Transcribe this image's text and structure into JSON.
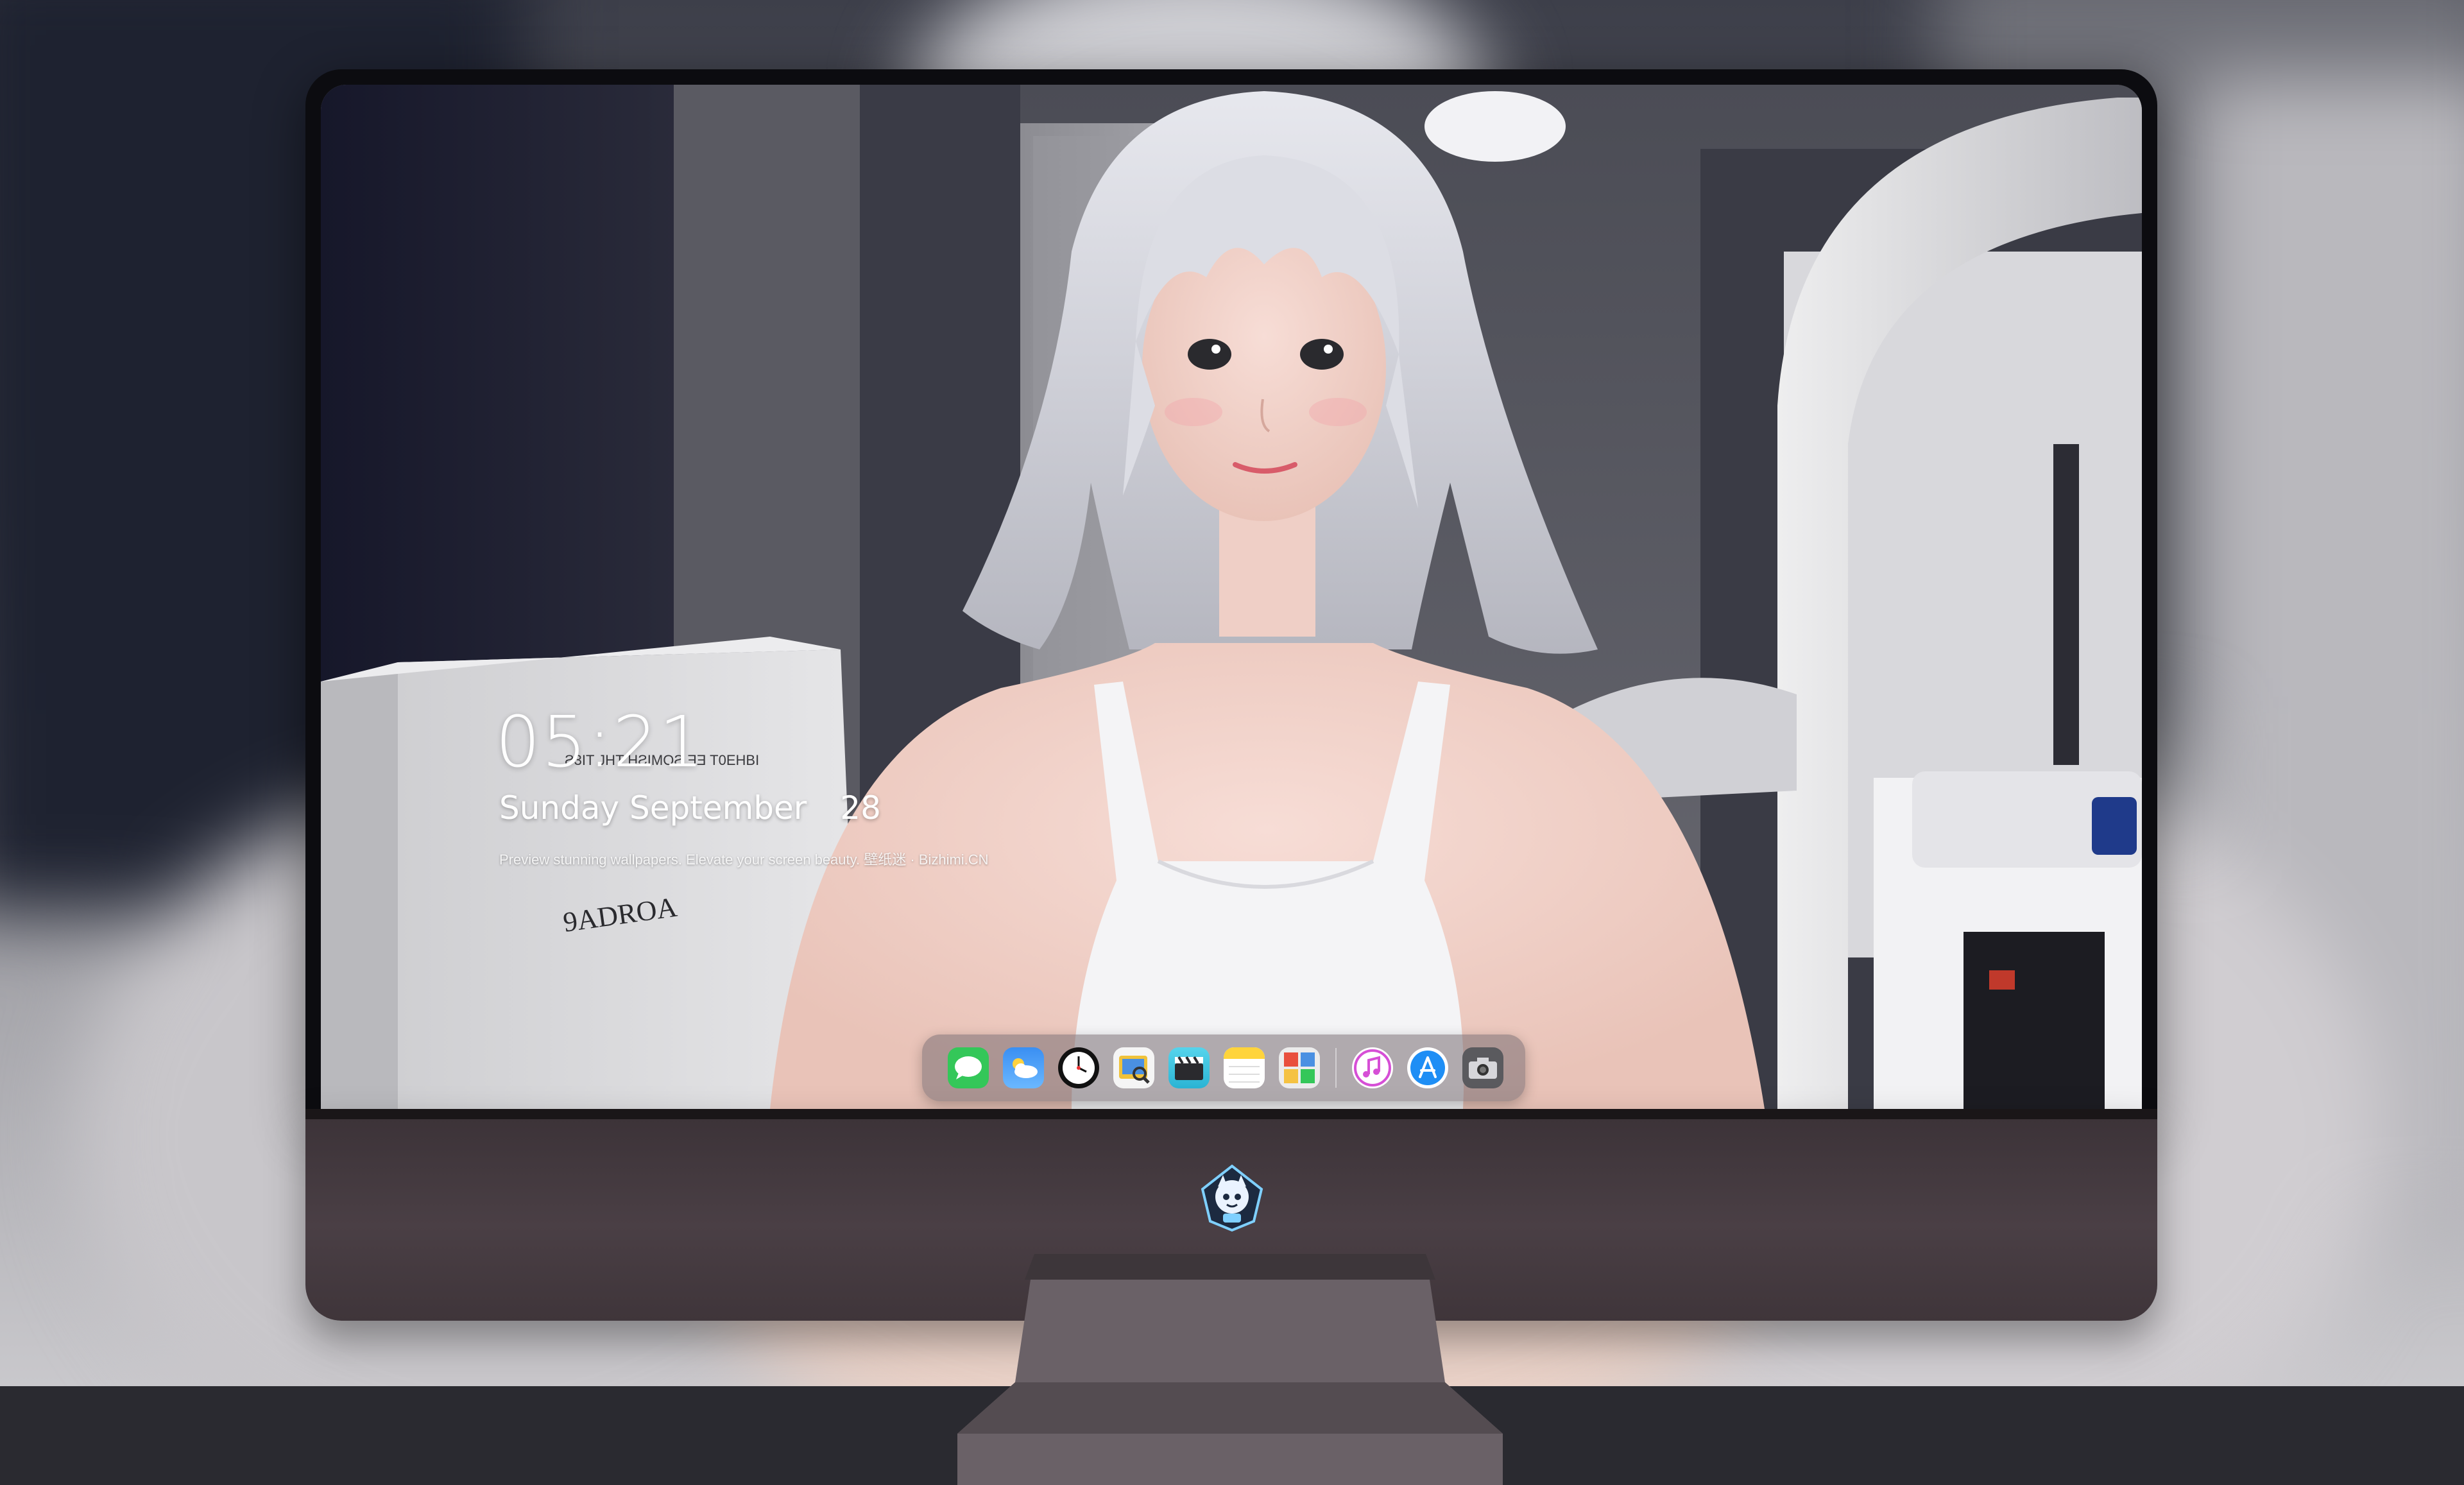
{
  "lockscreen": {
    "time": "05:21",
    "weekday": "Sunday",
    "month": "September",
    "day": "28",
    "tagline": "Preview stunning wallpapers. Elevate your screen beauty. 壁纸迷 · Bizhimi.CN"
  },
  "wallpaper": {
    "box_text_top": "Ƨ3IT JHT HƧIMOƧ ƎƎ T0EHBI",
    "box_text_brand": "9ADROA"
  },
  "dock": {
    "apps": [
      {
        "name": "Messages",
        "icon": "messages-icon",
        "color": "#34c759"
      },
      {
        "name": "Weather",
        "icon": "weather-icon",
        "color": "#2f8cf0"
      },
      {
        "name": "Clock",
        "icon": "clock-icon",
        "color": "#111111"
      },
      {
        "name": "Preview",
        "icon": "preview-icon",
        "color": "#f0c23a"
      },
      {
        "name": "Clips",
        "icon": "clapboard-icon",
        "color": "#3ec6e0"
      },
      {
        "name": "Notes",
        "icon": "notes-icon",
        "color": "#ffd43b"
      },
      {
        "name": "Photo Booth",
        "icon": "photo-grid-icon",
        "color": "#e94f3d"
      },
      {
        "name": "Music",
        "icon": "music-icon",
        "color": "#d64fd6"
      },
      {
        "name": "App Store",
        "icon": "app-store-icon",
        "color": "#1e8ef5"
      },
      {
        "name": "Camera",
        "icon": "camera-icon",
        "color": "#5a5a5e"
      }
    ]
  },
  "monitor": {
    "logo": "mascot-logo-icon"
  }
}
